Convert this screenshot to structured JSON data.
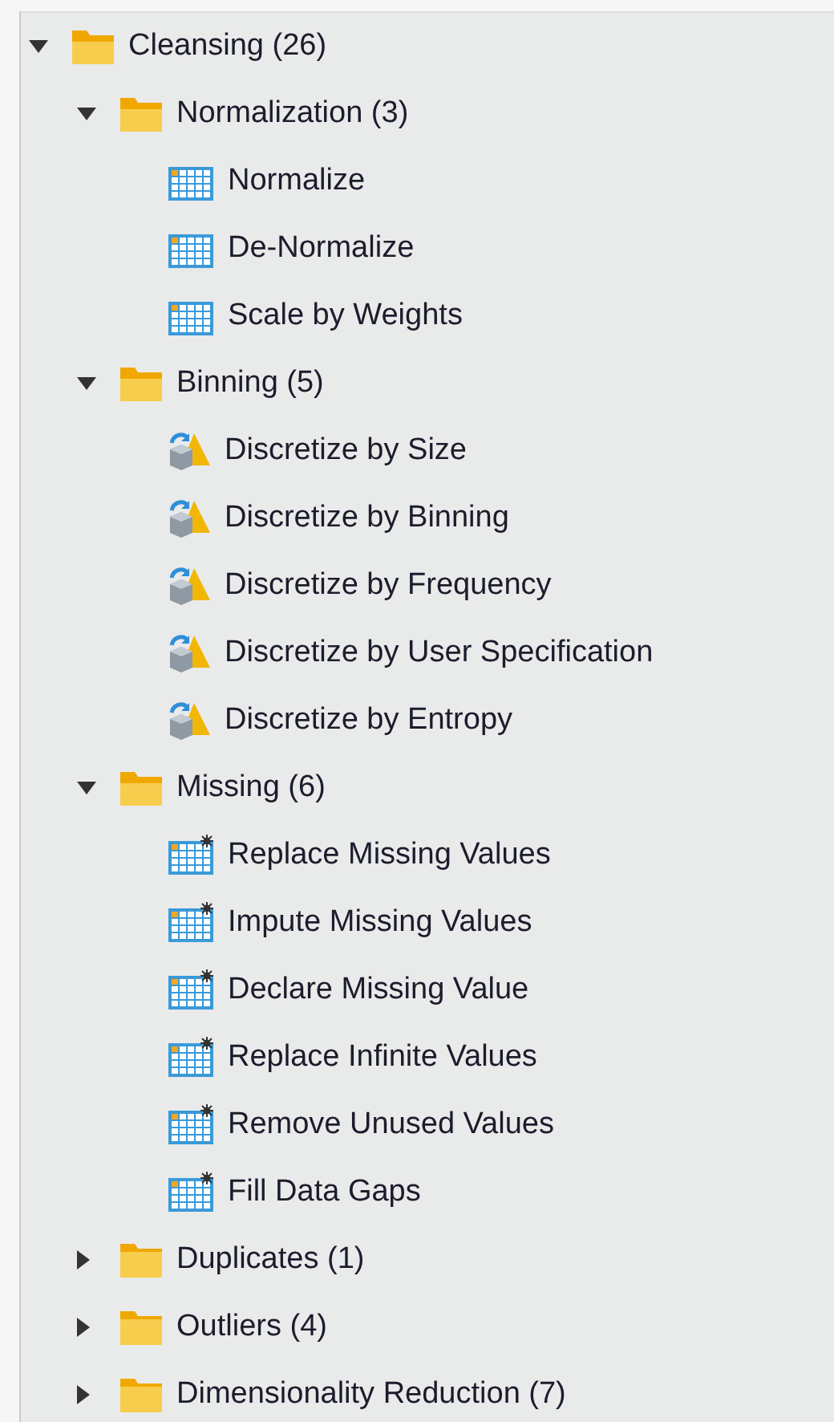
{
  "tree": [
    {
      "kind": "folder",
      "label": "Cleansing (26)",
      "expanded": true,
      "children": [
        {
          "kind": "folder",
          "label": "Normalization (3)",
          "expanded": true,
          "children": [
            {
              "kind": "table",
              "label": "Normalize"
            },
            {
              "kind": "table",
              "label": "De-Normalize"
            },
            {
              "kind": "table",
              "label": "Scale by Weights"
            }
          ]
        },
        {
          "kind": "folder",
          "label": "Binning (5)",
          "expanded": true,
          "children": [
            {
              "kind": "discretize",
              "label": "Discretize by Size"
            },
            {
              "kind": "discretize",
              "label": "Discretize by Binning"
            },
            {
              "kind": "discretize",
              "label": "Discretize by Frequency"
            },
            {
              "kind": "discretize",
              "label": "Discretize by User Specification"
            },
            {
              "kind": "discretize",
              "label": "Discretize by Entropy"
            }
          ]
        },
        {
          "kind": "folder",
          "label": "Missing (6)",
          "expanded": true,
          "children": [
            {
              "kind": "missing",
              "label": "Replace Missing Values"
            },
            {
              "kind": "missing",
              "label": "Impute Missing Values"
            },
            {
              "kind": "missing",
              "label": "Declare Missing Value"
            },
            {
              "kind": "missing",
              "label": "Replace Infinite Values"
            },
            {
              "kind": "missing",
              "label": "Remove Unused Values"
            },
            {
              "kind": "missing",
              "label": "Fill Data Gaps"
            }
          ]
        },
        {
          "kind": "folder",
          "label": "Duplicates (1)",
          "expanded": false
        },
        {
          "kind": "folder",
          "label": "Outliers (4)",
          "expanded": false
        },
        {
          "kind": "folder",
          "label": "Dimensionality Reduction (7)",
          "expanded": false
        }
      ]
    }
  ]
}
